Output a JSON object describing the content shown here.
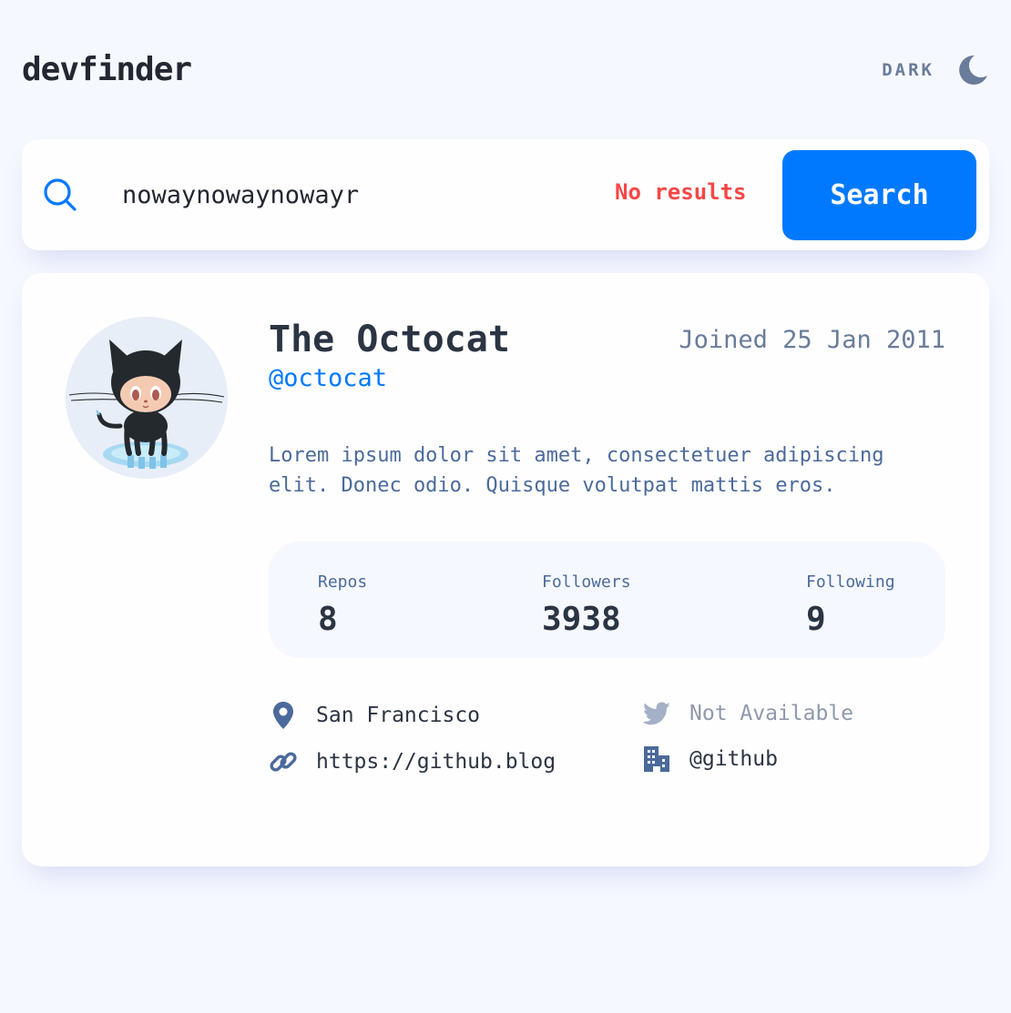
{
  "app": {
    "logo": "devfinder",
    "theme_toggle_label": "DARK"
  },
  "search": {
    "value": "nowaynowaynowayr",
    "error": "No results",
    "button_label": "Search"
  },
  "profile": {
    "name": "The Octocat",
    "login": "@octocat",
    "joined": "Joined 25 Jan 2011",
    "bio": "Lorem ipsum dolor sit amet, consectetuer adipiscing elit. Donec odio. Quisque volutpat mattis eros.",
    "stats": {
      "repos_label": "Repos",
      "repos": "8",
      "followers_label": "Followers",
      "followers": "3938",
      "following_label": "Following",
      "following": "9"
    },
    "links": {
      "location": "San Francisco",
      "twitter": "Not Available",
      "blog": "https://github.blog",
      "company": "@github"
    }
  },
  "icons": {
    "theme": "moon-icon",
    "search": "search-icon",
    "location": "location-pin-icon",
    "twitter": "twitter-icon",
    "blog": "link-icon",
    "company": "building-icon"
  },
  "colors": {
    "background": "#F6F8FF",
    "surface": "#FEFEFE",
    "accent": "#0079FF",
    "error": "#F74646",
    "text_dark": "#2B3442",
    "text_muted": "#4B6A9B",
    "text_gray": "#697C9A"
  }
}
